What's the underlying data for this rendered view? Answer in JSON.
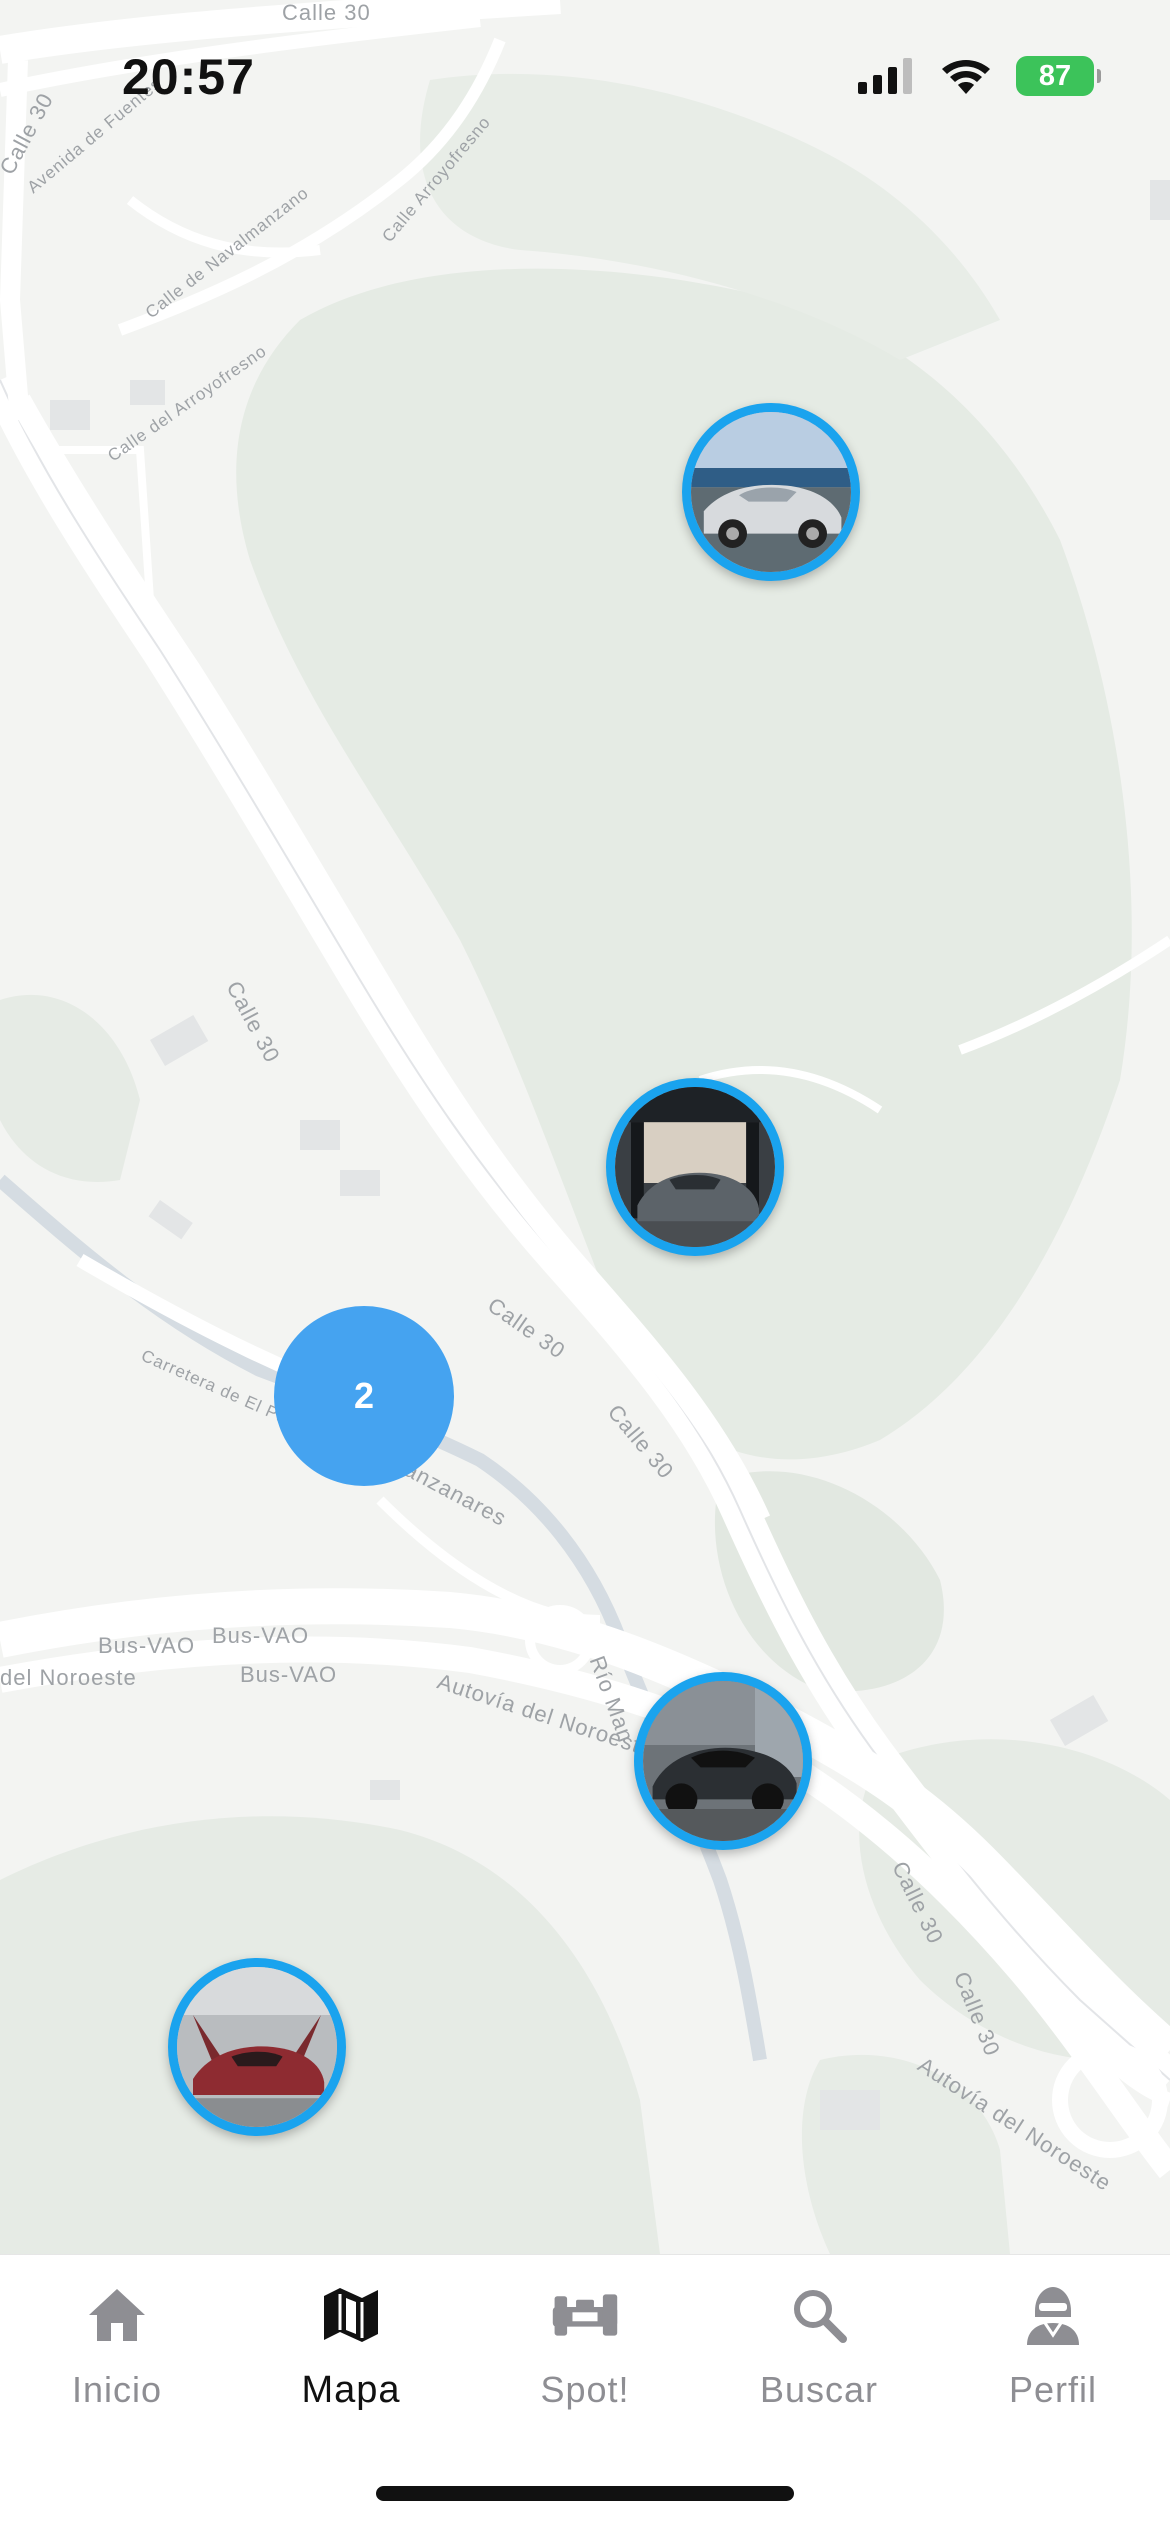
{
  "status_bar": {
    "time": "20:57",
    "battery": "87",
    "icons": [
      "signal-icon",
      "wifi-icon",
      "battery-charging-icon"
    ]
  },
  "map": {
    "road_labels": {
      "calle30_top": "Calle 30",
      "calle30_left": "Calle 30",
      "calle30_a": "Calle 30",
      "calle30_b": "Calle 30",
      "calle30_c": "Calle 30",
      "calle30_d": "Calle 30",
      "calle30_e": "Calle 30",
      "calle30_f": "Calle 30",
      "avenida_fuentes": "Avenida de Fuentes",
      "calle_navalmanzano": "Calle de Navalmanzano",
      "calle_arroyofresno": "Calle Arroyofresno",
      "calle_del_arroyofresno": "Calle del Arroyofresno",
      "carretera_pardo": "Carretera de El Pardo a la Playa",
      "rio_manzanares": "Río Manzanares",
      "rio_man": "Río Man",
      "busvao_1": "Bus-VAO",
      "busvao_2": "Bus-VAO",
      "busvao_3": "Bus-VAO",
      "del_noroeste": "del Noroeste",
      "autovia_noroeste_1": "Autovía del Noroeste",
      "autovia_noroeste_2": "Autovía del Noroeste"
    },
    "cluster": {
      "count": "2",
      "color": "#45a3f0"
    },
    "marker_border_color": "#1aa3ee",
    "markers": [
      {
        "name": "silver-convertible-photo"
      },
      {
        "name": "grey-sportscar-garage-photo"
      },
      {
        "name": "dark-supercar-photo"
      },
      {
        "name": "red-hypercar-photo"
      }
    ]
  },
  "tabbar": {
    "tabs": [
      {
        "label": "Inicio",
        "icon": "home-icon",
        "active": false
      },
      {
        "label": "Mapa",
        "icon": "map-icon",
        "active": true
      },
      {
        "label": "Spot!",
        "icon": "car-spot-icon",
        "active": false
      },
      {
        "label": "Buscar",
        "icon": "search-icon",
        "active": false
      },
      {
        "label": "Perfil",
        "icon": "helmet-driver-icon",
        "active": false
      }
    ]
  }
}
